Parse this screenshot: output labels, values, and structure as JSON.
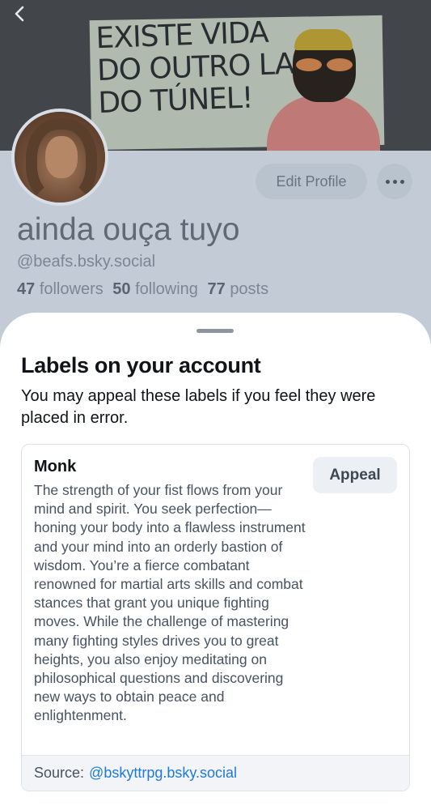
{
  "banner": {
    "text_lines": [
      "EXISTE VIDA",
      "DO OUTRO LADO",
      "DO TÚNEL!"
    ]
  },
  "profile": {
    "edit_label": "Edit Profile",
    "display_name": "ainda ouça tuyo",
    "handle": "@beafs.bsky.social",
    "followers_count": "47",
    "followers_label": "followers",
    "following_count": "50",
    "following_label": "following",
    "posts_count": "77",
    "posts_label": "posts"
  },
  "sheet": {
    "title": "Labels on your account",
    "description": "You may appeal these labels if you feel they were placed in error.",
    "label": {
      "name": "Monk",
      "appeal_label": "Appeal",
      "description": "The strength of your fist flows from your mind and spirit. You seek perfection—honing your body into a flawless instrument and your mind into an orderly bastion of wisdom. You’re a fierce combatant renowned for martial arts skills and combat stances that grant you unique fighting moves. While the challenge of mastering many fighting styles drives you to great heights, you also enjoy meditating on philosophical questions and discovering new ways to obtain peace and enlightenment.",
      "source_prefix": "Source:",
      "source_link": "@bskyttrpg.bsky.social"
    }
  },
  "icons": {
    "back": "chevron-left-icon",
    "more": "ellipsis-icon"
  },
  "colors": {
    "link": "#1e7ad8",
    "title": "#101418",
    "muted": "#475361"
  }
}
